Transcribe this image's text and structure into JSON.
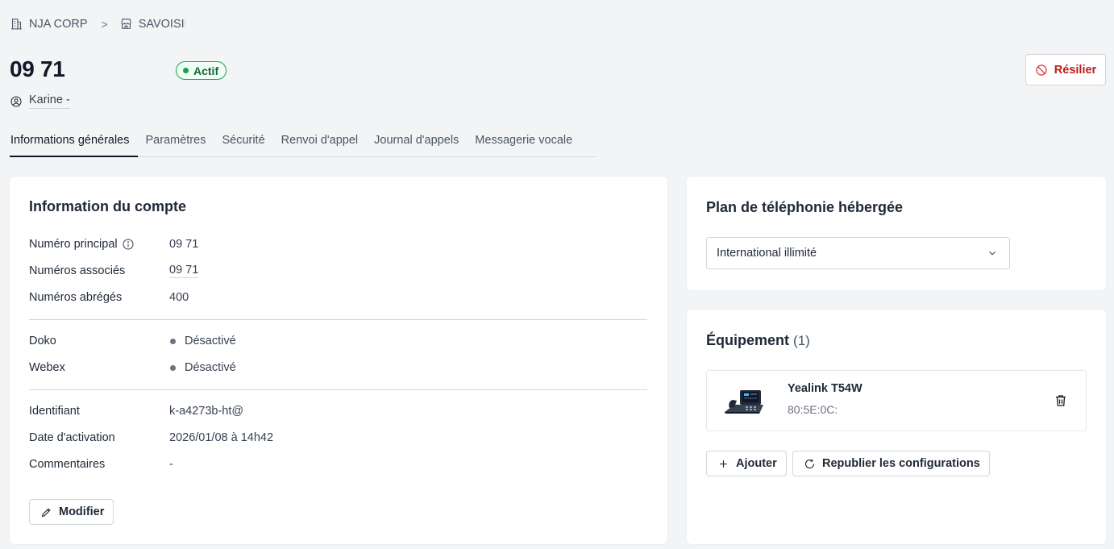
{
  "breadcrumb": {
    "company": "NJA CORP",
    "site": "SAVOISIEN"
  },
  "header": {
    "title": "09 71",
    "status": "Actif",
    "user": "Karine -",
    "resilier_label": "Résilier"
  },
  "tabs": [
    {
      "label": "Informations générales",
      "active": true
    },
    {
      "label": "Paramètres"
    },
    {
      "label": "Sécurité"
    },
    {
      "label": "Renvoi d'appel"
    },
    {
      "label": "Journal d'appels"
    },
    {
      "label": "Messagerie vocale"
    }
  ],
  "account": {
    "title": "Information du compte",
    "main_number_label": "Numéro principal",
    "main_number_value": "09 71",
    "associated_label": "Numéros associés",
    "associated_value": "09 71",
    "short_label": "Numéros abrégés",
    "short_value": "400",
    "doko_label": "Doko",
    "doko_value": "Désactivé",
    "webex_label": "Webex",
    "webex_value": "Désactivé",
    "identifier_label": "Identifiant",
    "identifier_value": "k-a4273b-ht@",
    "activation_label": "Date d'activation",
    "activation_value": "2026/01/08 à 14h42",
    "comments_label": "Commentaires",
    "comments_value": "-",
    "edit_label": "Modifier"
  },
  "plan": {
    "title": "Plan de téléphonie hébergée",
    "selected": "International illimité"
  },
  "equipment": {
    "title": "Équipement",
    "count": "(1)",
    "device_name": "Yealink T54W",
    "device_mac": "80:5E:0C:",
    "add_label": "Ajouter",
    "republish_label": "Republier les configurations"
  },
  "colors": {
    "active_green": "#16a34a",
    "danger_red": "#dc2626"
  }
}
